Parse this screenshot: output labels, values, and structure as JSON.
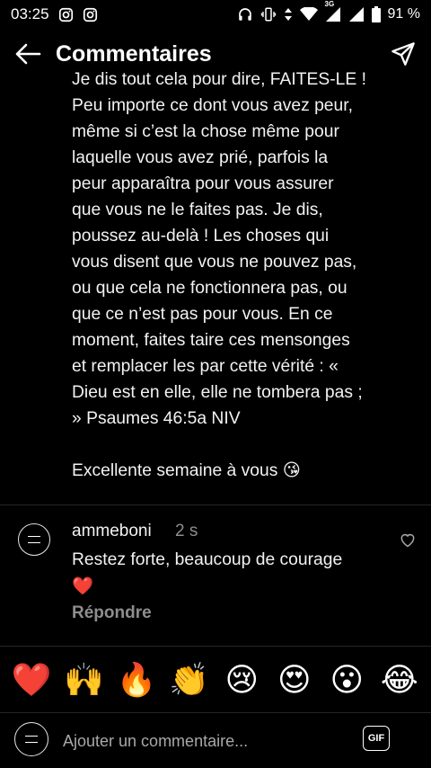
{
  "status_bar": {
    "time": "03:25",
    "network": "3G",
    "battery": "91 %"
  },
  "header": {
    "title": "Commentaires"
  },
  "caption": {
    "lines": [
      "Je dis tout cela pour dire, FAITES-LE !",
      "Peu importe ce dont vous avez peur,",
      "même si c’est la chose même pour",
      "laquelle vous avez prié, parfois la",
      "peur apparaîtra pour vous assurer",
      "que vous ne le faites pas. Je dis,",
      "poussez au-delà ! Les choses qui",
      "vous disent que vous ne pouvez pas,",
      "ou que cela ne fonctionnera pas, ou",
      "que ce n’est pas pour vous. En ce",
      "moment, faites taire ces mensonges",
      "et remplacer les par cette vérité : «",
      "Dieu est en elle, elle ne tombera pas ;",
      "» Psaumes 46:5a NIV"
    ],
    "closing": "Excellente semaine à vous 😘"
  },
  "comment": {
    "username": "ammeboni",
    "time": "2 s",
    "text": "Restez forte, beaucoup de courage",
    "emoji": "❤️",
    "reply_label": "Répondre"
  },
  "emoji_bar": [
    "❤️",
    "🙌",
    "🔥",
    "👏",
    "😢",
    "😍",
    "😮",
    "😂"
  ],
  "composer": {
    "placeholder": "Ajouter un commentaire...",
    "gif_label": "GIF"
  }
}
